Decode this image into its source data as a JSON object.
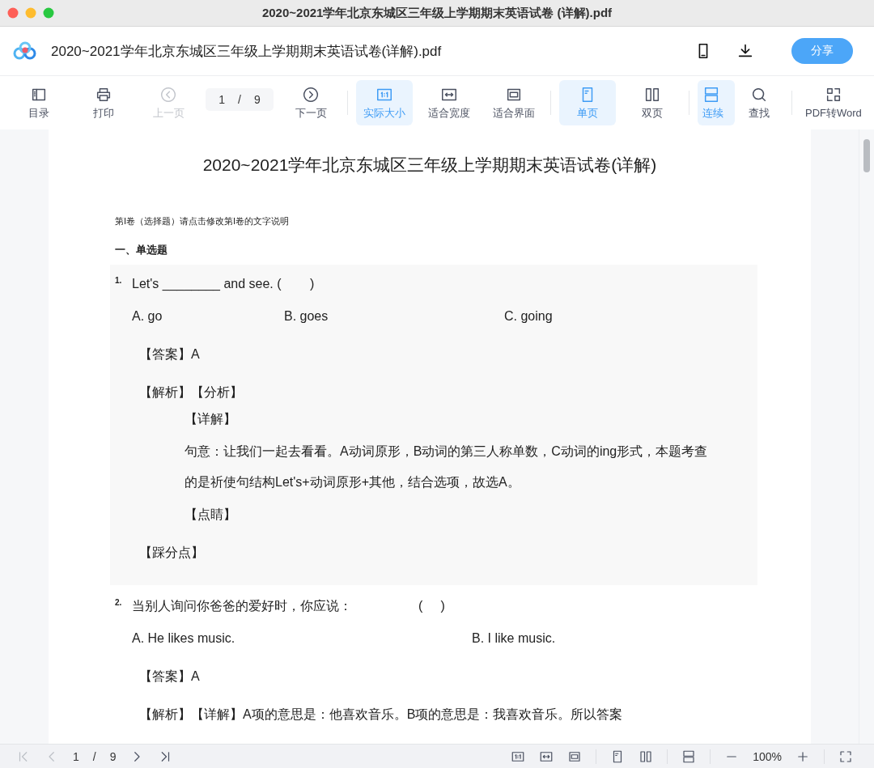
{
  "window": {
    "title": "2020~2021学年北京东城区三年级上学期期末英语试卷 (详解).pdf"
  },
  "header": {
    "file_name": "2020~2021学年北京东城区三年级上学期期末英语试卷(详解).pdf",
    "share_button": "分享"
  },
  "toolbar": [
    {
      "kind": "button",
      "label": "目录",
      "selected": false,
      "disabled": false
    },
    {
      "kind": "button",
      "label": "打印",
      "selected": false,
      "disabled": false
    },
    {
      "kind": "button",
      "label": "上一页",
      "selected": false,
      "disabled": true
    },
    {
      "kind": "page",
      "current": "1",
      "separator": "/",
      "total": "9"
    },
    {
      "kind": "button",
      "label": "下一页",
      "selected": false,
      "disabled": false
    },
    {
      "kind": "divider"
    },
    {
      "kind": "button",
      "label": "实际大小",
      "selected": true,
      "disabled": false
    },
    {
      "kind": "button",
      "label": "适合宽度",
      "selected": false,
      "disabled": false
    },
    {
      "kind": "button",
      "label": "适合界面",
      "selected": false,
      "disabled": false
    },
    {
      "kind": "divider"
    },
    {
      "kind": "button",
      "label": "单页",
      "selected": true,
      "disabled": false
    },
    {
      "kind": "button",
      "label": "双页",
      "selected": false,
      "disabled": false
    },
    {
      "kind": "divider"
    },
    {
      "kind": "button",
      "label": "连续",
      "selected": true,
      "disabled": false
    },
    {
      "kind": "button",
      "label": "查找",
      "selected": false,
      "disabled": false
    },
    {
      "kind": "divider"
    },
    {
      "kind": "button",
      "label": "PDF转Word",
      "selected": false,
      "disabled": false
    }
  ],
  "document": {
    "title": "2020~2021学年北京东城区三年级上学期期末英语试卷(详解)",
    "instructions": "第I卷（选择题）请点击修改第I卷的文字说明",
    "section": "一、单选题",
    "questions": [
      {
        "number": "1.",
        "stem": "Let's ________ and see. (        )",
        "highlighted": true,
        "options": [
          "A. go",
          "B. goes",
          "C. going"
        ],
        "lines": [
          {
            "kind": "answer",
            "text": "【答案】A"
          },
          {
            "kind": "answer",
            "text": "【解析】【分析】"
          },
          {
            "kind": "detail",
            "text": "【详解】"
          },
          {
            "kind": "detail",
            "text": "句意：让我们一起去看看。A动词原形，B动词的第三人称单数，C动词的ing形式，本题考查的是祈使句结构Let's+动词原形+其他，结合选项，故选A。"
          },
          {
            "kind": "detail",
            "text": "【点睛】"
          },
          {
            "kind": "answer",
            "text": "【踩分点】"
          }
        ]
      },
      {
        "number": "2.",
        "stem": "当别人询问你爸爸的爱好时，你应说：",
        "bracket": "(     )",
        "highlighted": false,
        "options": [
          "A. He likes music.",
          "B. I like music."
        ],
        "lines": [
          {
            "kind": "answer",
            "text": "【答案】A"
          },
          {
            "kind": "answer",
            "text": "【解析】【详解】A项的意思是：他喜欢音乐。B项的意思是：我喜欢音乐。所以答案"
          }
        ]
      }
    ]
  },
  "bottom_bar": {
    "left": [
      {
        "kind": "button",
        "disabled": true
      },
      {
        "kind": "button",
        "disabled": true
      },
      {
        "kind": "text",
        "text": "1"
      },
      {
        "kind": "text",
        "text": "/"
      },
      {
        "kind": "text",
        "text": "9"
      },
      {
        "kind": "button",
        "disabled": false
      },
      {
        "kind": "button",
        "disabled": false
      }
    ],
    "right": [
      {
        "kind": "button",
        "disabled": false
      },
      {
        "kind": "button",
        "disabled": false
      },
      {
        "kind": "button",
        "disabled": false
      },
      {
        "kind": "divider"
      },
      {
        "kind": "button",
        "disabled": false
      },
      {
        "kind": "button",
        "disabled": false
      },
      {
        "kind": "divider"
      },
      {
        "kind": "button",
        "disabled": false
      },
      {
        "kind": "divider"
      },
      {
        "kind": "button",
        "disabled": false
      },
      {
        "kind": "text",
        "text": "100%"
      },
      {
        "kind": "button",
        "disabled": false
      },
      {
        "kind": "divider"
      },
      {
        "kind": "button",
        "disabled": false
      }
    ]
  }
}
